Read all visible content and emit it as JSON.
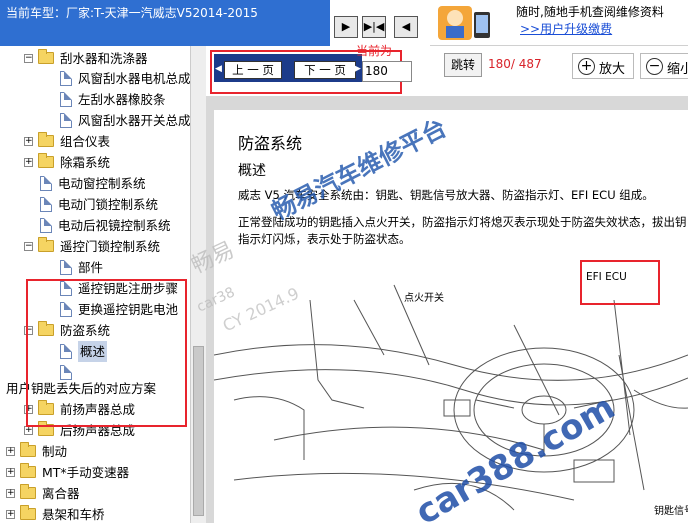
{
  "window": {
    "vehicle_prefix": "当前车型：",
    "vehicle_name": "厂家:T-天津一汽威志V52014-2015"
  },
  "top_nav": {
    "buttons": [
      "▶",
      "▶|◀",
      "◀"
    ]
  },
  "ad": {
    "line1": "随时,随地手机查阅维修资料",
    "line2": ">>用户升级缴费"
  },
  "tree": {
    "nodes": [
      {
        "label": "刮水器和洗涤器",
        "type": "folder",
        "expander": "-",
        "level": 1
      },
      {
        "label": "风窗刮水器电机总成",
        "type": "page",
        "level": 2
      },
      {
        "label": "左刮水器橡胶条",
        "type": "page",
        "level": 2
      },
      {
        "label": "风窗刮水器开关总成",
        "type": "page",
        "level": 2
      },
      {
        "label": "组合仪表",
        "type": "folder",
        "expander": "+",
        "level": 1
      },
      {
        "label": "除霜系统",
        "type": "folder",
        "expander": "+",
        "level": 1
      },
      {
        "label": "电动窗控制系统",
        "type": "page",
        "level": 1
      },
      {
        "label": "电动门锁控制系统",
        "type": "page",
        "level": 1
      },
      {
        "label": "电动后视镜控制系统",
        "type": "page",
        "level": 1
      },
      {
        "label": "遥控门锁控制系统",
        "type": "folder",
        "expander": "-",
        "level": 1
      },
      {
        "label": "部件",
        "type": "page",
        "level": 2
      },
      {
        "label": "遥控钥匙注册步骤",
        "type": "page",
        "level": 2
      },
      {
        "label": "更换遥控钥匙电池",
        "type": "page",
        "level": 2
      },
      {
        "label": "防盗系统",
        "type": "folder",
        "expander": "-",
        "level": 1
      },
      {
        "label": "概述",
        "type": "page",
        "level": 2,
        "selected": true
      },
      {
        "label": "",
        "type": "page",
        "level": 2
      },
      {
        "label": "用户钥匙丢失后的对应方案",
        "type": "text",
        "level": 0
      },
      {
        "label": "前扬声器总成",
        "type": "folder",
        "expander": "+",
        "level": 1
      },
      {
        "label": "后扬声器总成",
        "type": "folder",
        "expander": "+",
        "level": 1
      },
      {
        "label": "制动",
        "type": "folder",
        "expander": "+",
        "level": 0
      },
      {
        "label": "MT*手动变速器",
        "type": "folder",
        "expander": "+",
        "level": 0
      },
      {
        "label": "离合器",
        "type": "folder",
        "expander": "+",
        "level": 0
      },
      {
        "label": "悬架和车桥",
        "type": "folder",
        "expander": "+",
        "level": 0
      }
    ]
  },
  "toolbar": {
    "prev_label": "上 一 页",
    "next_label": "下 一 页",
    "current_label": "当前为",
    "page_value": "180",
    "jump_label": "跳转",
    "page_count": "180/ 487",
    "zoom_in_label": "放大",
    "zoom_out_label": "缩小"
  },
  "document": {
    "title": "防盗系统",
    "subtitle": "概述",
    "para1": "威志 V5 汽车安全系统由：钥匙、钥匙信号放大器、防盗指示灯、EFI ECU 组成。",
    "para2": "正常登陆成功的钥匙插入点火开关，防盗指示灯将熄灭表示现处于防盗失效状态，拔出钥",
    "para3": "指示灯闪烁，表示处于防盗状态。",
    "label_ignition": "点火开关",
    "label_ecu": "EFI ECU",
    "label_key": "钥匙信号"
  },
  "watermarks": {
    "blue": "畅易汽车维修平台",
    "grey1": "畅易",
    "grey2": "car38",
    "grey3": "CY 2014.9",
    "site": "car388.com"
  },
  "colors": {
    "accent_blue": "#2f6fd1",
    "pager_blue": "#1c3b8a",
    "highlight_red": "#e8242d",
    "link_blue": "#1a4ed6",
    "folder_yellow": "#f5d462"
  }
}
